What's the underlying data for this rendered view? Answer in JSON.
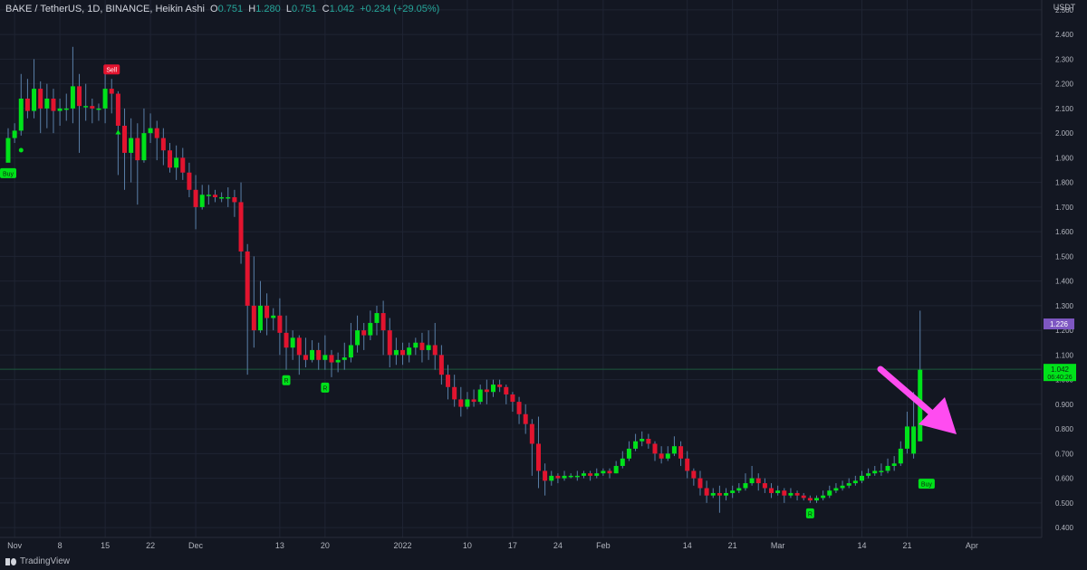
{
  "legend": {
    "symbol": "BAKE / TetherUS, 1D, BINANCE, Heikin Ashi",
    "o_label": "O",
    "o": "0.751",
    "h_label": "H",
    "h": "1.280",
    "l_label": "L",
    "l": "0.751",
    "c_label": "C",
    "c": "1.042",
    "change": "+0.234 (+29.05%)"
  },
  "currency_label": "USDT",
  "watermark": "TradingView",
  "colors": {
    "background": "#131722",
    "grid": "#1f2433",
    "bull": "#00e21a",
    "bear": "#e2142f",
    "axis_text": "#b2b5be",
    "price_line": "#1d5a3c",
    "arrow": "#ff4cf0",
    "purple_label": "#7e57c2"
  },
  "chart_data": {
    "type": "candlestick",
    "ylim": [
      0.36,
      2.54
    ],
    "y_ticks": [
      "0.400",
      "0.500",
      "0.600",
      "0.700",
      "0.800",
      "0.900",
      "1.000",
      "1.100",
      "1.200",
      "1.300",
      "1.400",
      "1.500",
      "1.600",
      "1.700",
      "1.800",
      "1.900",
      "2.000",
      "2.100",
      "2.200",
      "2.300",
      "2.400",
      "2.500"
    ],
    "x_ticks": [
      {
        "index": 1,
        "label": "Nov"
      },
      {
        "index": 8,
        "label": "8"
      },
      {
        "index": 15,
        "label": "15"
      },
      {
        "index": 22,
        "label": "22"
      },
      {
        "index": 29,
        "label": "Dec"
      },
      {
        "index": 42,
        "label": "13"
      },
      {
        "index": 49,
        "label": "20"
      },
      {
        "index": 61,
        "label": "2022"
      },
      {
        "index": 71,
        "label": "10"
      },
      {
        "index": 78,
        "label": "17"
      },
      {
        "index": 85,
        "label": "24"
      },
      {
        "index": 92,
        "label": "Feb"
      },
      {
        "index": 105,
        "label": "14"
      },
      {
        "index": 112,
        "label": "21"
      },
      {
        "index": 119,
        "label": "Mar"
      },
      {
        "index": 132,
        "label": "14"
      },
      {
        "index": 139,
        "label": "21"
      },
      {
        "index": 149,
        "label": "Apr"
      }
    ],
    "candles": [
      [
        1.88,
        1.98,
        1.92,
        2.02
      ],
      [
        1.98,
        2.01,
        1.96,
        2.04
      ],
      [
        2.01,
        2.14,
        1.99,
        2.24
      ],
      [
        2.14,
        2.09,
        2.06,
        2.22
      ],
      [
        2.09,
        2.18,
        2.06,
        2.3
      ],
      [
        2.18,
        2.1,
        2.0,
        2.21
      ],
      [
        2.1,
        2.14,
        2.02,
        2.2
      ],
      [
        2.14,
        2.09,
        2.0,
        2.18
      ],
      [
        2.09,
        2.1,
        2.03,
        2.14
      ],
      [
        2.1,
        2.1,
        2.05,
        2.16
      ],
      [
        2.1,
        2.19,
        2.04,
        2.35
      ],
      [
        2.19,
        2.11,
        1.92,
        2.24
      ],
      [
        2.11,
        2.11,
        2.05,
        2.2
      ],
      [
        2.11,
        2.1,
        2.04,
        2.14
      ],
      [
        2.1,
        2.1,
        2.05,
        2.12
      ],
      [
        2.1,
        2.18,
        2.04,
        2.26
      ],
      [
        2.18,
        2.16,
        2.08,
        2.22
      ],
      [
        2.16,
        2.03,
        1.83,
        2.17
      ],
      [
        2.03,
        1.92,
        1.77,
        2.1
      ],
      [
        1.92,
        1.98,
        1.8,
        2.06
      ],
      [
        1.98,
        1.89,
        1.71,
        2.04
      ],
      [
        1.89,
        2.0,
        1.88,
        2.1
      ],
      [
        2.0,
        2.02,
        1.96,
        2.08
      ],
      [
        2.02,
        1.98,
        1.89,
        2.05
      ],
      [
        1.98,
        1.93,
        1.87,
        2.02
      ],
      [
        1.93,
        1.86,
        1.84,
        1.96
      ],
      [
        1.86,
        1.9,
        1.81,
        1.95
      ],
      [
        1.9,
        1.84,
        1.81,
        1.94
      ],
      [
        1.84,
        1.77,
        1.74,
        1.88
      ],
      [
        1.77,
        1.7,
        1.61,
        1.83
      ],
      [
        1.7,
        1.75,
        1.69,
        1.79
      ],
      [
        1.75,
        1.75,
        1.71,
        1.79
      ],
      [
        1.75,
        1.74,
        1.72,
        1.77
      ],
      [
        1.74,
        1.74,
        1.72,
        1.76
      ],
      [
        1.74,
        1.74,
        1.7,
        1.78
      ],
      [
        1.74,
        1.72,
        1.66,
        1.77
      ],
      [
        1.72,
        1.52,
        1.47,
        1.8
      ],
      [
        1.52,
        1.3,
        1.02,
        1.55
      ],
      [
        1.3,
        1.2,
        1.13,
        1.5
      ],
      [
        1.2,
        1.3,
        1.19,
        1.4
      ],
      [
        1.3,
        1.25,
        1.18,
        1.35
      ],
      [
        1.25,
        1.26,
        1.2,
        1.29
      ],
      [
        1.26,
        1.19,
        1.1,
        1.33
      ],
      [
        1.19,
        1.13,
        1.04,
        1.26
      ],
      [
        1.13,
        1.17,
        1.08,
        1.2
      ],
      [
        1.17,
        1.1,
        1.02,
        1.18
      ],
      [
        1.1,
        1.08,
        1.05,
        1.17
      ],
      [
        1.08,
        1.12,
        1.07,
        1.16
      ],
      [
        1.12,
        1.08,
        1.04,
        1.15
      ],
      [
        1.08,
        1.1,
        1.04,
        1.18
      ],
      [
        1.1,
        1.07,
        1.01,
        1.12
      ],
      [
        1.07,
        1.08,
        1.03,
        1.11
      ],
      [
        1.08,
        1.09,
        1.04,
        1.15
      ],
      [
        1.09,
        1.14,
        1.07,
        1.23
      ],
      [
        1.14,
        1.2,
        1.11,
        1.26
      ],
      [
        1.2,
        1.18,
        1.12,
        1.23
      ],
      [
        1.18,
        1.23,
        1.16,
        1.28
      ],
      [
        1.23,
        1.27,
        1.18,
        1.3
      ],
      [
        1.27,
        1.2,
        1.1,
        1.32
      ],
      [
        1.2,
        1.1,
        1.05,
        1.25
      ],
      [
        1.1,
        1.12,
        1.06,
        1.17
      ],
      [
        1.12,
        1.1,
        1.06,
        1.15
      ],
      [
        1.1,
        1.13,
        1.07,
        1.15
      ],
      [
        1.13,
        1.15,
        1.1,
        1.17
      ],
      [
        1.15,
        1.12,
        1.07,
        1.19
      ],
      [
        1.12,
        1.14,
        1.08,
        1.2
      ],
      [
        1.14,
        1.1,
        1.04,
        1.23
      ],
      [
        1.1,
        1.02,
        0.98,
        1.14
      ],
      [
        1.02,
        0.97,
        0.92,
        1.06
      ],
      [
        0.97,
        0.92,
        0.89,
        1.02
      ],
      [
        0.92,
        0.89,
        0.85,
        0.97
      ],
      [
        0.89,
        0.92,
        0.88,
        0.95
      ],
      [
        0.92,
        0.91,
        0.89,
        0.96
      ],
      [
        0.91,
        0.96,
        0.9,
        0.98
      ],
      [
        0.96,
        0.95,
        0.9,
        1.0
      ],
      [
        0.95,
        0.98,
        0.93,
        1.0
      ],
      [
        0.98,
        0.97,
        0.95,
        1.0
      ],
      [
        0.97,
        0.94,
        0.9,
        0.98
      ],
      [
        0.94,
        0.91,
        0.87,
        0.95
      ],
      [
        0.91,
        0.86,
        0.82,
        0.93
      ],
      [
        0.86,
        0.82,
        0.78,
        0.9
      ],
      [
        0.82,
        0.74,
        0.61,
        0.84
      ],
      [
        0.74,
        0.63,
        0.56,
        0.85
      ],
      [
        0.63,
        0.59,
        0.53,
        0.66
      ],
      [
        0.59,
        0.61,
        0.57,
        0.63
      ],
      [
        0.61,
        0.6,
        0.58,
        0.62
      ],
      [
        0.6,
        0.61,
        0.59,
        0.63
      ],
      [
        0.61,
        0.61,
        0.6,
        0.62
      ],
      [
        0.61,
        0.61,
        0.59,
        0.63
      ],
      [
        0.61,
        0.62,
        0.6,
        0.63
      ],
      [
        0.62,
        0.61,
        0.59,
        0.63
      ],
      [
        0.61,
        0.62,
        0.6,
        0.64
      ],
      [
        0.62,
        0.63,
        0.61,
        0.64
      ],
      [
        0.63,
        0.62,
        0.6,
        0.64
      ],
      [
        0.62,
        0.65,
        0.62,
        0.67
      ],
      [
        0.65,
        0.68,
        0.64,
        0.71
      ],
      [
        0.68,
        0.72,
        0.67,
        0.75
      ],
      [
        0.72,
        0.75,
        0.71,
        0.78
      ],
      [
        0.75,
        0.76,
        0.73,
        0.79
      ],
      [
        0.76,
        0.74,
        0.72,
        0.78
      ],
      [
        0.74,
        0.7,
        0.67,
        0.75
      ],
      [
        0.7,
        0.68,
        0.66,
        0.73
      ],
      [
        0.68,
        0.7,
        0.67,
        0.73
      ],
      [
        0.7,
        0.73,
        0.69,
        0.77
      ],
      [
        0.73,
        0.68,
        0.65,
        0.75
      ],
      [
        0.68,
        0.63,
        0.6,
        0.71
      ],
      [
        0.63,
        0.6,
        0.57,
        0.64
      ],
      [
        0.6,
        0.56,
        0.53,
        0.63
      ],
      [
        0.56,
        0.53,
        0.5,
        0.59
      ],
      [
        0.53,
        0.54,
        0.52,
        0.56
      ],
      [
        0.54,
        0.53,
        0.46,
        0.57
      ],
      [
        0.53,
        0.54,
        0.51,
        0.56
      ],
      [
        0.54,
        0.55,
        0.52,
        0.57
      ],
      [
        0.55,
        0.56,
        0.54,
        0.58
      ],
      [
        0.56,
        0.58,
        0.55,
        0.62
      ],
      [
        0.58,
        0.6,
        0.57,
        0.65
      ],
      [
        0.6,
        0.58,
        0.55,
        0.62
      ],
      [
        0.58,
        0.56,
        0.54,
        0.6
      ],
      [
        0.56,
        0.54,
        0.52,
        0.58
      ],
      [
        0.54,
        0.55,
        0.53,
        0.57
      ],
      [
        0.55,
        0.53,
        0.5,
        0.56
      ],
      [
        0.53,
        0.54,
        0.52,
        0.56
      ],
      [
        0.54,
        0.53,
        0.51,
        0.55
      ],
      [
        0.53,
        0.52,
        0.51,
        0.54
      ],
      [
        0.52,
        0.51,
        0.5,
        0.53
      ],
      [
        0.51,
        0.52,
        0.5,
        0.53
      ],
      [
        0.52,
        0.53,
        0.51,
        0.55
      ],
      [
        0.53,
        0.55,
        0.52,
        0.57
      ],
      [
        0.55,
        0.56,
        0.54,
        0.58
      ],
      [
        0.56,
        0.57,
        0.55,
        0.59
      ],
      [
        0.57,
        0.58,
        0.56,
        0.6
      ],
      [
        0.58,
        0.59,
        0.57,
        0.61
      ],
      [
        0.59,
        0.61,
        0.58,
        0.63
      ],
      [
        0.61,
        0.62,
        0.6,
        0.64
      ],
      [
        0.62,
        0.63,
        0.61,
        0.65
      ],
      [
        0.63,
        0.63,
        0.61,
        0.66
      ],
      [
        0.63,
        0.65,
        0.62,
        0.68
      ],
      [
        0.65,
        0.66,
        0.63,
        0.69
      ],
      [
        0.66,
        0.72,
        0.65,
        0.75
      ],
      [
        0.72,
        0.81,
        0.7,
        0.87
      ],
      [
        0.7,
        0.81,
        0.68,
        0.95
      ],
      [
        0.75,
        1.04,
        0.75,
        1.28
      ]
    ],
    "current_price": 1.042,
    "price_label": "1.042",
    "countdown_label": "06:40:26",
    "high_marker": 1.226,
    "high_label": "1.226",
    "markers": [
      {
        "index": 0,
        "price": 1.88,
        "kind": "label",
        "text": "Buy",
        "color": "bull",
        "pos": "below"
      },
      {
        "index": 2,
        "price": 1.96,
        "kind": "dot",
        "color": "bull",
        "pos": "below"
      },
      {
        "index": 16,
        "price": 2.22,
        "kind": "label",
        "text": "Sell",
        "color": "bear",
        "pos": "above"
      },
      {
        "index": 17,
        "price": 2.05,
        "kind": "triangle",
        "color": "bull",
        "pos": "below"
      },
      {
        "index": 43,
        "price": 1.04,
        "kind": "label",
        "text": "R",
        "color": "bull",
        "pos": "below"
      },
      {
        "index": 49,
        "price": 1.01,
        "kind": "label",
        "text": "R",
        "color": "bull",
        "pos": "below"
      },
      {
        "index": 124,
        "price": 0.5,
        "kind": "label",
        "text": "R",
        "color": "bull",
        "pos": "below"
      },
      {
        "index": 142,
        "price": 0.62,
        "kind": "label",
        "text": "Buy",
        "color": "bull",
        "pos": "below"
      }
    ]
  }
}
